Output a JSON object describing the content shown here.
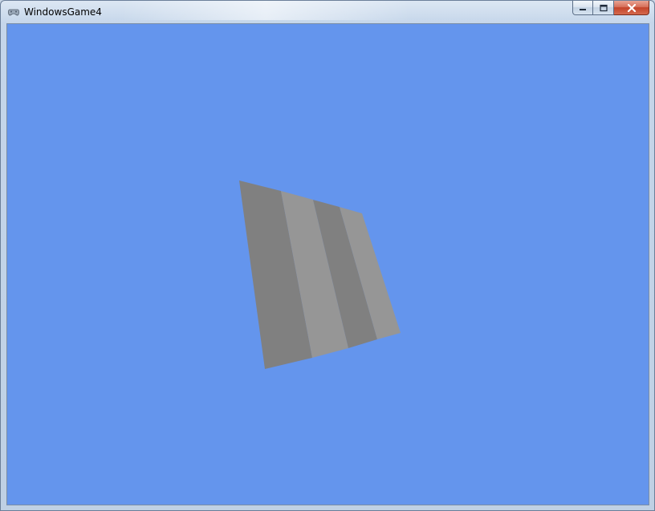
{
  "window": {
    "title": "WindowsGame4"
  },
  "caption_buttons": {
    "minimize_icon": "minimize-icon",
    "maximize_icon": "maximize-icon",
    "close_icon": "close-icon"
  },
  "colors": {
    "clear_color": "#6495ed",
    "stripe_dark": "#808080",
    "stripe_light": "#969696"
  },
  "scene": {
    "object": "striped-quad",
    "stripe_count": 4
  }
}
